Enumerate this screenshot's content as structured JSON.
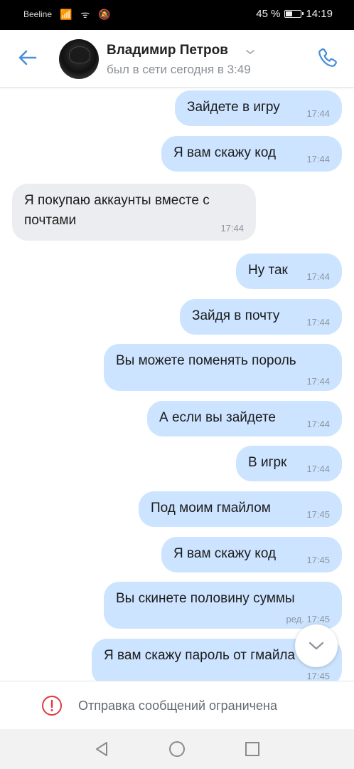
{
  "status_bar": {
    "carrier": "Beeline",
    "icons": "📶 ᯤ 🔕",
    "battery_percent": "45 %",
    "battery_level": 0.45,
    "time": "14:19"
  },
  "header": {
    "contact_name": "Владимир Петров",
    "last_seen": "был в сети сегодня в 3:49"
  },
  "messages": [
    {
      "dir": "out",
      "text": "Зайдете в игру",
      "time": "17:44"
    },
    {
      "dir": "out",
      "text": "Я вам скажу код",
      "time": "17:44"
    },
    {
      "dir": "in",
      "text": "Я покупаю аккаунты вместе с почтами",
      "time": "17:44"
    },
    {
      "dir": "out",
      "text": "Ну так",
      "time": "17:44"
    },
    {
      "dir": "out",
      "text": "Зайдя в почту",
      "time": "17:44"
    },
    {
      "dir": "out",
      "text": "Вы можете поменять пороль",
      "time": "17:44"
    },
    {
      "dir": "out",
      "text": "А если вы зайдете",
      "time": "17:44"
    },
    {
      "dir": "out",
      "text": "В игрк",
      "time": "17:44"
    },
    {
      "dir": "out",
      "text": "Под моим гмайлом",
      "time": "17:45"
    },
    {
      "dir": "out",
      "text": "Я вам скажу код",
      "time": "17:45"
    },
    {
      "dir": "out",
      "text": "Вы скинете половину суммы",
      "time": "ред. 17:45"
    },
    {
      "dir": "out",
      "text": "Я вам скажу пароль от гмайла",
      "time": "17:45"
    }
  ],
  "restriction": {
    "text": "Отправка сообщений ограничена"
  },
  "colors": {
    "accent": "#4a8fd9",
    "outgoing_bubble": "#cce4ff",
    "incoming_bubble": "#ebedf0",
    "warning": "#e0393e"
  }
}
